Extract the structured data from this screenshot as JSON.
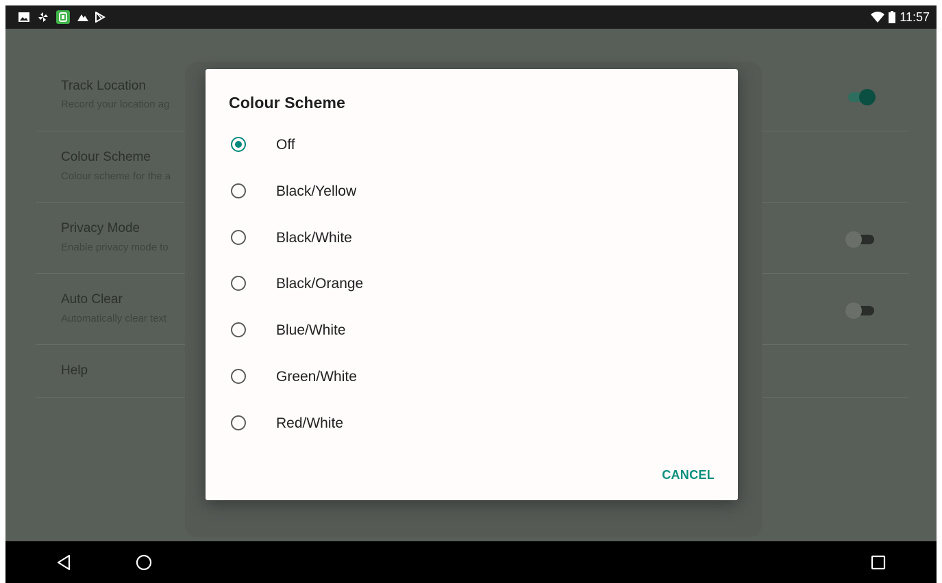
{
  "status_bar": {
    "time": "11:57",
    "left_icons": [
      "image-icon",
      "pinwheel-icon",
      "app-icon",
      "mountain-icon",
      "play-store-icon"
    ],
    "right_icons": [
      "wifi-icon",
      "battery-icon"
    ]
  },
  "preferences": [
    {
      "title": "Track Location",
      "subtitle": "Record your location ag",
      "toggle": true
    },
    {
      "title": "Colour Scheme",
      "subtitle": "Colour scheme for the a",
      "toggle": null
    },
    {
      "title": "Privacy Mode",
      "subtitle": "Enable privacy mode to",
      "toggle": false
    },
    {
      "title": "Auto Clear",
      "subtitle": "Automatically clear text",
      "toggle": false
    },
    {
      "title": "Help",
      "subtitle": "",
      "toggle": null
    }
  ],
  "dialog": {
    "title": "Colour Scheme",
    "selected_index": 0,
    "options": [
      "Off",
      "Black/Yellow",
      "Black/White",
      "Black/Orange",
      "Blue/White",
      "Green/White",
      "Red/White"
    ],
    "cancel_label": "CANCEL"
  },
  "nav_bar": {
    "icons": [
      "back-icon",
      "home-icon",
      "recents-icon"
    ]
  },
  "colors": {
    "accent": "#00897b",
    "toggle_on_track": "#2e6e5e",
    "toggle_on_thumb": "#0b4f42",
    "toggle_off_track": "#2a2d2a",
    "toggle_off_thumb": "#6a6f6a"
  }
}
